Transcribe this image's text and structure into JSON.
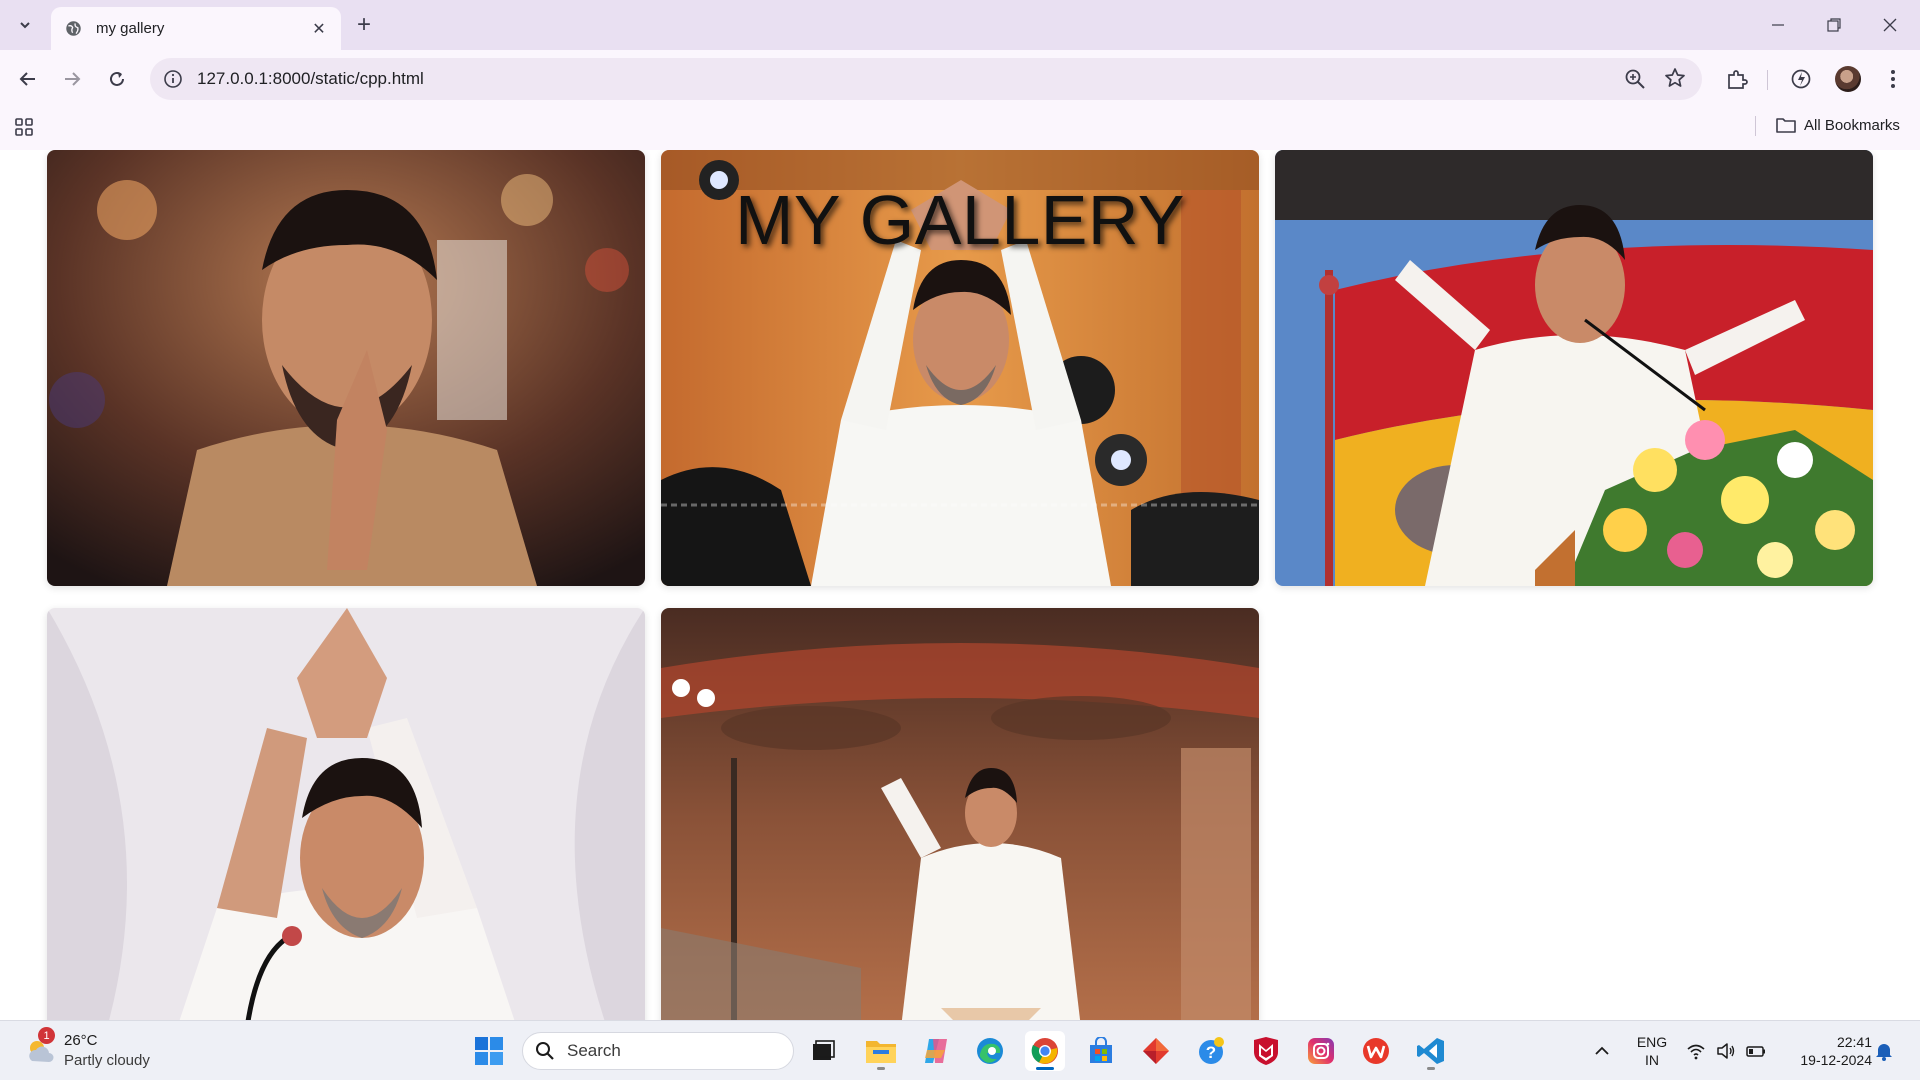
{
  "browser": {
    "tab_title": "my gallery",
    "url": "127.0.0.1:8000/static/cpp.html",
    "bookmarks_label": "All Bookmarks"
  },
  "page": {
    "heading": "MY GALLERY",
    "photos": [
      {
        "name": "gallery-photo-1",
        "subject": "man in beige shirt with folded hands, crowd background"
      },
      {
        "name": "gallery-photo-2",
        "subject": "man in white shirt with hands raised above head, orange stage"
      },
      {
        "name": "gallery-photo-3",
        "subject": "man at podium with flowers, thumbs up, flag background"
      },
      {
        "name": "gallery-photo-4",
        "subject": "man in white shirt with folded hands above head, white background"
      },
      {
        "name": "gallery-photo-5",
        "subject": "man in white shirt waving on stage"
      }
    ]
  },
  "taskbar": {
    "weather_temp": "26°C",
    "weather_condition": "Partly cloudy",
    "weather_badge": "1",
    "search_placeholder": "Search",
    "lang_top": "ENG",
    "lang_bottom": "IN",
    "time": "22:41",
    "date": "19-12-2024"
  },
  "colors": {
    "tabstrip": "#e9e0f2",
    "toolbar": "#fbf6fd",
    "taskbar": "#eef0f6"
  }
}
